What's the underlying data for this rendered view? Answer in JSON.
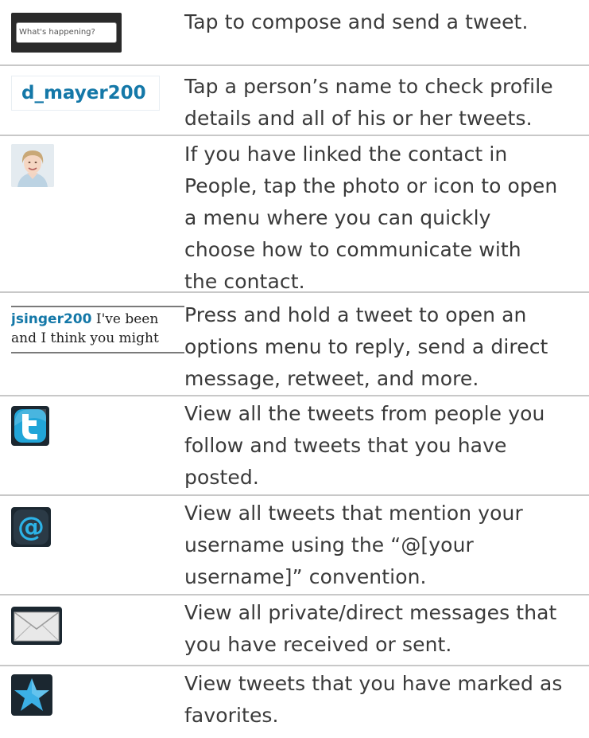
{
  "rows": [
    {
      "sample": "What's happening?",
      "description": "Tap to compose and send a tweet."
    },
    {
      "sample": "d_mayer200",
      "description": "Tap a person’s name to check profile details and all of his or her tweets."
    },
    {
      "sample_icon": "contact-photo",
      "description": "If you have linked the contact in People, tap the photo or icon to open a menu where you can quickly choose how to communicate with the contact."
    },
    {
      "sample_user": "jsinger200",
      "sample_line1": "I've been",
      "sample_line2": "and I think you might",
      "description": "Press and hold a tweet to open an options menu to reply, send a direct message, retweet, and more."
    },
    {
      "sample_icon": "twitter-icon",
      "description": "View all the tweets from people you follow and tweets that you have posted."
    },
    {
      "sample_icon": "at-sign-icon",
      "description": "View all tweets that mention your username using the “@[your username]” convention."
    },
    {
      "sample_icon": "envelope-icon",
      "description": "View all private/direct messages that you have received or sent."
    },
    {
      "sample_icon": "star-icon",
      "description": "View tweets that you have marked as favorites."
    }
  ],
  "colors": {
    "link_blue": "#1478a8",
    "text": "#3a3a3a",
    "divider": "#c8c8c8"
  }
}
